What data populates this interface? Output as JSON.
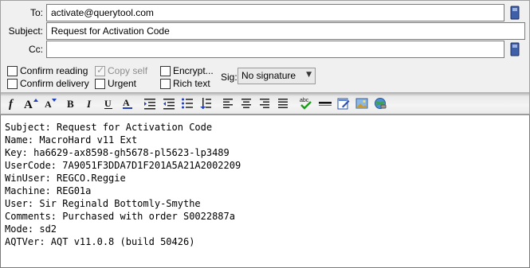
{
  "fields": {
    "to": {
      "label": "To:",
      "value": "activate@querytool.com"
    },
    "subject": {
      "label": "Subject:",
      "value": "Request for Activation Code"
    },
    "cc": {
      "label": "Cc:",
      "value": ""
    }
  },
  "options": {
    "confirm_reading": {
      "label": "Confirm reading",
      "checked": false
    },
    "confirm_delivery": {
      "label": "Confirm delivery",
      "checked": false
    },
    "copy_self": {
      "label": "Copy self",
      "checked": true,
      "disabled": true
    },
    "urgent": {
      "label": "Urgent",
      "checked": false
    },
    "encrypt": {
      "label": "Encrypt...",
      "checked": false
    },
    "rich_text": {
      "label": "Rich text",
      "checked": false
    }
  },
  "signature": {
    "label": "Sig:",
    "selected": "No signature"
  },
  "toolbar": {
    "icons": [
      "font-icon",
      "increase-font-size-icon",
      "decrease-font-size-icon",
      "bold-icon",
      "italic-icon",
      "underline-icon",
      "font-color-icon",
      "indent-icon",
      "outdent-icon",
      "bullet-list-icon",
      "numbered-list-icon",
      "align-left-icon",
      "align-center-icon",
      "align-right-icon",
      "justify-icon",
      "spell-check-icon",
      "horizontal-rule-icon",
      "edit-icon",
      "insert-image-icon",
      "insert-link-icon"
    ]
  },
  "message": {
    "lines": [
      "Subject: Request for Activation Code",
      "Name: MacroHard v11 Ext",
      "Key: ha6629-ax8598-gh5678-pl5623-lp3489",
      "UserCode: 7A9051F3DDA7D1F201A5A21A2002209",
      "WinUser: REGCO.Reggie",
      "Machine: REG01a",
      "User: Sir Reginald Bottomly-Smythe",
      "Comments: Purchased with order S0022887a",
      "Mode: sd2",
      "AQTVer: AQT v11.0.8 (build 50426)"
    ]
  },
  "colors": {
    "book_icon": "#3f5fa8",
    "spell_check": "#1f9a1f",
    "font_color_underline": "#1f3fbf"
  }
}
